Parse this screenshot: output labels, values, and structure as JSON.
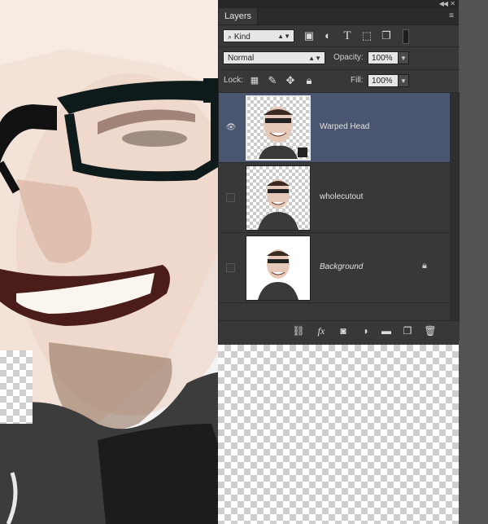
{
  "panel": {
    "tab_label": "Layers",
    "filter": {
      "label": "Kind"
    },
    "blend_mode": "Normal",
    "opacity": {
      "label": "Opacity:",
      "value": "100%"
    },
    "lock": {
      "label": "Lock:"
    },
    "fill": {
      "label": "Fill:",
      "value": "100%"
    },
    "layers": [
      {
        "name": "Warped Head",
        "selected": true,
        "visible": true,
        "locked": false,
        "italic": false
      },
      {
        "name": "wholecutout",
        "selected": false,
        "visible": false,
        "locked": false,
        "italic": false
      },
      {
        "name": "Background",
        "selected": false,
        "visible": false,
        "locked": true,
        "italic": true
      }
    ]
  },
  "icons": {
    "filter_search": "search-icon",
    "filter_types": [
      "image-icon",
      "adjustment-icon",
      "type-icon",
      "shape-icon",
      "smart-object-icon"
    ],
    "lock": [
      "lock-transparent-icon",
      "lock-brush-icon",
      "lock-move-icon",
      "lock-all-icon"
    ],
    "footer": [
      "link-icon",
      "fx-icon",
      "mask-icon",
      "adjustment-layer-icon",
      "group-folder-icon",
      "new-layer-icon",
      "trash-icon"
    ]
  },
  "colors": {
    "panel_bg": "#383838",
    "selected_layer": "#4a5670",
    "app_bg": "#535353"
  }
}
